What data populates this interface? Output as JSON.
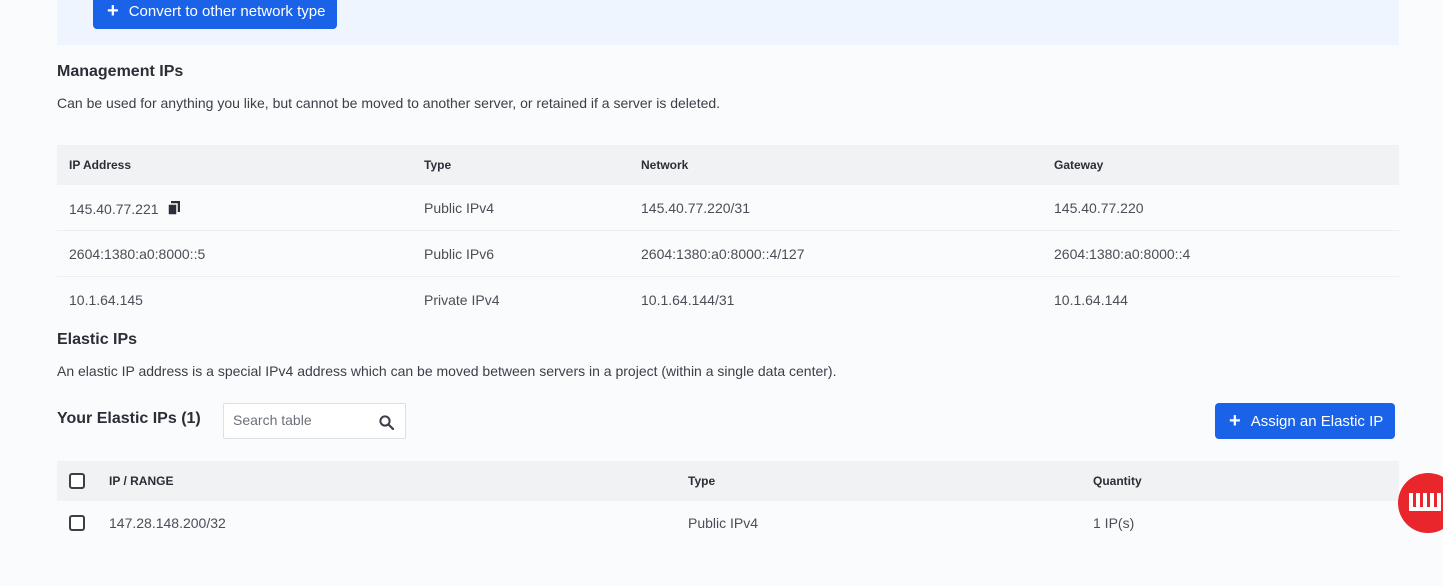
{
  "banner": {
    "convert_label": "Convert to other network type"
  },
  "management": {
    "title": "Management IPs",
    "description": "Can be used for anything you like, but cannot be moved to another server, or retained if a server is deleted.",
    "columns": [
      "IP Address",
      "Type",
      "Network",
      "Gateway"
    ],
    "rows": [
      {
        "ip": "145.40.77.221",
        "type": "Public IPv4",
        "network": "145.40.77.220/31",
        "gateway": "145.40.77.220"
      },
      {
        "ip": "2604:1380:a0:8000::5",
        "type": "Public IPv6",
        "network": "2604:1380:a0:8000::4/127",
        "gateway": "2604:1380:a0:8000::4"
      },
      {
        "ip": "10.1.64.145",
        "type": "Private IPv4",
        "network": "10.1.64.144/31",
        "gateway": "10.1.64.144"
      }
    ]
  },
  "elastic": {
    "title": "Elastic IPs",
    "description": "An elastic IP address is a special IPv4 address which can be moved between servers in a project (within a single data center).",
    "your_title": "Your Elastic IPs (1)",
    "search_placeholder": "Search table",
    "assign_label": "Assign an Elastic IP",
    "columns": [
      "IP / RANGE",
      "Type",
      "Quantity"
    ],
    "rows": [
      {
        "range": "147.28.148.200/32",
        "type": "Public IPv4",
        "quantity": "1 IP(s)"
      }
    ]
  },
  "icons": {
    "copy": "copy-icon",
    "search": "search-icon",
    "plus": "plus-icon",
    "brand": "equinix-logo-icon"
  },
  "colors": {
    "primary": "#1a63e8",
    "brand": "#e9262b",
    "banner_bg": "#eef5fe"
  }
}
